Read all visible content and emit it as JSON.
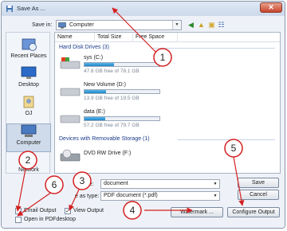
{
  "title": "Save As ...",
  "save_in": {
    "label": "Save in:",
    "value": "Computer"
  },
  "places": [
    "Recent Places",
    "Desktop",
    "OJ",
    "Computer",
    "Network"
  ],
  "columns": [
    "Name",
    "Total Size",
    "Free Space"
  ],
  "groups": {
    "hard": "Hard Disk Drives (3)",
    "removable": "Devices with Removable Storage (1)"
  },
  "drives": [
    {
      "name": "sys (C:)",
      "info": "47.6 GB free of 78.1 GB",
      "used_fraction": 0.39
    },
    {
      "name": "New Volume (D:)",
      "info": "13.9 GB free of 19.5 GB",
      "used_fraction": 0.29
    },
    {
      "name": "data (E:)",
      "info": "57.2 GB free of 79.7 GB",
      "used_fraction": 0.28
    }
  ],
  "dvd": {
    "name": "DVD RW Drive (F:)"
  },
  "file_name": {
    "label": "name:",
    "value": "document"
  },
  "save_type": {
    "label": "e as type:",
    "value": "PDF document (*.pdf)"
  },
  "buttons": {
    "save": "Save",
    "cancel": "Cancel",
    "watermark": "Watermark ...",
    "configure": "Configure Output"
  },
  "checkboxes": [
    {
      "label": "Email Output",
      "checked": false
    },
    {
      "label": "Open in PDFdesktop",
      "checked": false
    },
    {
      "label": "View Output",
      "checked": true
    }
  ],
  "callouts": [
    "1",
    "2",
    "3",
    "4",
    "5",
    "6"
  ],
  "colors": {
    "callout": "#d42020",
    "drive_fill": "#1e86c8"
  }
}
